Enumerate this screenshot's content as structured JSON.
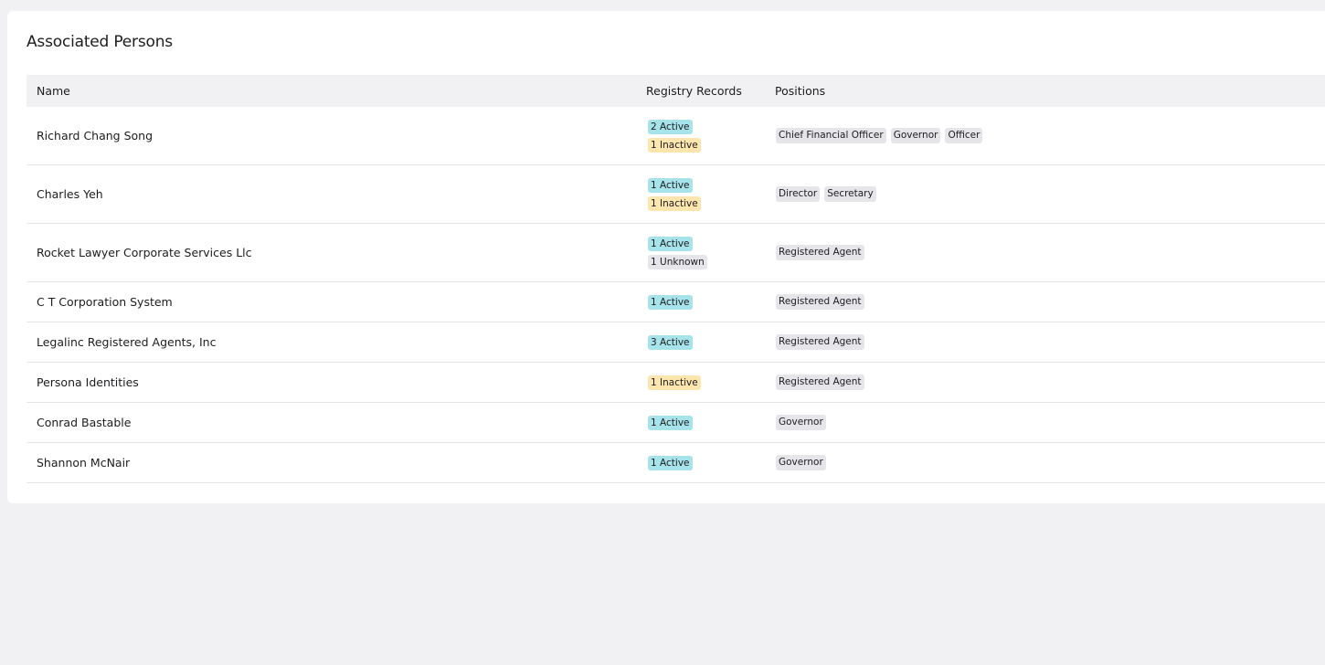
{
  "card": {
    "title": "Associated Persons"
  },
  "table": {
    "headers": {
      "name": "Name",
      "registry": "Registry Records",
      "positions": "Positions"
    },
    "rows": [
      {
        "name": "Richard Chang Song",
        "records": [
          {
            "label": "2 Active",
            "status": "active"
          },
          {
            "label": "1 Inactive",
            "status": "inactive"
          }
        ],
        "positions": [
          "Chief Financial Officer",
          "Governor",
          "Officer"
        ]
      },
      {
        "name": "Charles Yeh",
        "records": [
          {
            "label": "1 Active",
            "status": "active"
          },
          {
            "label": "1 Inactive",
            "status": "inactive"
          }
        ],
        "positions": [
          "Director",
          "Secretary"
        ]
      },
      {
        "name": "Rocket Lawyer Corporate Services Llc",
        "records": [
          {
            "label": "1 Active",
            "status": "active"
          },
          {
            "label": "1 Unknown",
            "status": "unknown"
          }
        ],
        "positions": [
          "Registered Agent"
        ]
      },
      {
        "name": "C T Corporation System",
        "records": [
          {
            "label": "1 Active",
            "status": "active"
          }
        ],
        "positions": [
          "Registered Agent"
        ]
      },
      {
        "name": "Legalinc Registered Agents, Inc",
        "records": [
          {
            "label": "3 Active",
            "status": "active"
          }
        ],
        "positions": [
          "Registered Agent"
        ]
      },
      {
        "name": "Persona Identities",
        "records": [
          {
            "label": "1 Inactive",
            "status": "inactive"
          }
        ],
        "positions": [
          "Registered Agent"
        ]
      },
      {
        "name": "Conrad Bastable",
        "records": [
          {
            "label": "1 Active",
            "status": "active"
          }
        ],
        "positions": [
          "Governor"
        ]
      },
      {
        "name": "Shannon McNair",
        "records": [
          {
            "label": "1 Active",
            "status": "active"
          }
        ],
        "positions": [
          "Governor"
        ]
      }
    ]
  },
  "colors": {
    "active": "#a6e3ea",
    "inactive": "#fde6ae",
    "unknown": "#e6e6ea",
    "position_tag": "#e6e6ea",
    "page_background": "#f1f1f3"
  }
}
